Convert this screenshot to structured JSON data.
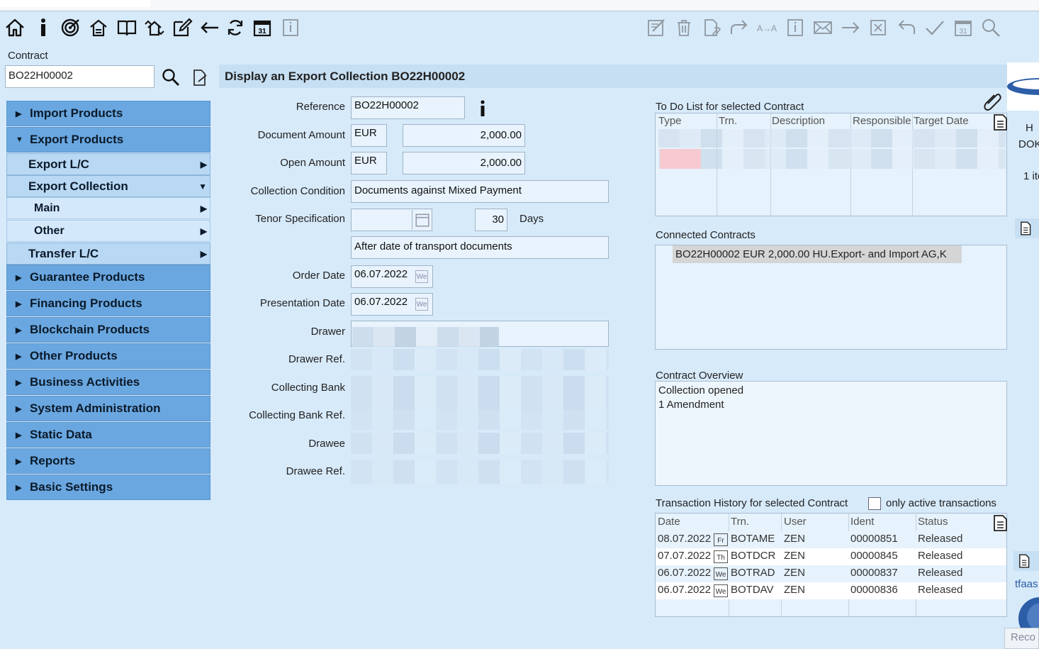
{
  "toolbar_left": [
    "home-icon",
    "info-icon",
    "target-icon",
    "hand-house-icon",
    "book-icon",
    "house-arrows-icon",
    "edit-icon",
    "back-arrow-icon",
    "refresh-icon",
    "calendar-icon",
    "info-box-icon"
  ],
  "toolbar_right": [
    "edit-sign-icon",
    "delete-icon",
    "document-attach-icon",
    "forward-icon",
    "transfer-icon",
    "info-box-icon",
    "mail-icon",
    "arrow-right-icon",
    "close-box-icon",
    "undo-icon",
    "check-icon",
    "calendar-icon",
    "search-icon"
  ],
  "contract": {
    "label": "Contract",
    "value": "BO22H00002"
  },
  "nav": {
    "import": "Import Products",
    "export": "Export Products",
    "export_lc": "Export L/C",
    "export_collection": "Export Collection",
    "main": "Main",
    "other": "Other",
    "transfer_lc": "Transfer L/C",
    "guarantee": "Guarantee Products",
    "financing": "Financing Products",
    "blockchain": "Blockchain Products",
    "other_products": "Other Products",
    "business": "Business Activities",
    "sysadmin": "System Administration",
    "static": "Static Data",
    "reports": "Reports",
    "basic": "Basic Settings"
  },
  "title": "Display an Export Collection BO22H00002",
  "form": {
    "reference_label": "Reference",
    "reference": "BO22H00002",
    "doc_amount_label": "Document Amount",
    "doc_currency": "EUR",
    "doc_amount": "2,000.00",
    "open_amount_label": "Open Amount",
    "open_currency": "EUR",
    "open_amount": "2,000.00",
    "collection_condition_label": "Collection Condition",
    "collection_condition": "Documents against Mixed Payment",
    "tenor_label": "Tenor Specification",
    "tenor_days": "30",
    "days_label": "Days",
    "tenor_text": "After date of transport documents",
    "order_date_label": "Order Date",
    "order_date": "06.07.2022",
    "presentation_date_label": "Presentation Date",
    "presentation_date": "06.07.2022",
    "drawer_label": "Drawer",
    "drawer_ref_label": "Drawer Ref.",
    "collecting_bank_label": "Collecting Bank",
    "collecting_bank_ref_label": "Collecting Bank Ref.",
    "drawee_label": "Drawee",
    "drawee_ref_label": "Drawee Ref."
  },
  "todo": {
    "title": "To Do List for selected Contract",
    "headers": [
      "Type",
      "Trn.",
      "Description",
      "Responsible",
      "Target Date"
    ]
  },
  "connected": {
    "title": "Connected Contracts",
    "item": "BO22H00002 EUR 2,000.00 HU.Export- and Import AG,K"
  },
  "overview": {
    "title": "Contract Overview",
    "line1": "Collection opened",
    "line2": "1 Amendment"
  },
  "history": {
    "title": "Transaction History for selected Contract",
    "only_active": "only active transactions",
    "headers": [
      "Date",
      "Trn.",
      "User",
      "Ident",
      "Status"
    ],
    "rows": [
      {
        "date": "08.07.2022",
        "badge": "Fr",
        "trn": "BOTAME",
        "user": "ZEN",
        "ident": "00000851",
        "status": "Released"
      },
      {
        "date": "07.07.2022",
        "badge": "Th",
        "trn": "BOTDCR",
        "user": "ZEN",
        "ident": "00000845",
        "status": "Released"
      },
      {
        "date": "06.07.2022",
        "badge": "We",
        "trn": "BOTRAD",
        "user": "ZEN",
        "ident": "00000837",
        "status": "Released"
      },
      {
        "date": "06.07.2022",
        "badge": "We",
        "trn": "BOTDAV",
        "user": "ZEN",
        "ident": "00000836",
        "status": "Released"
      }
    ]
  },
  "right_edge": {
    "t1": "H",
    "t2": "DOK",
    "t3": "1 ite",
    "t4": "tfaas",
    "t5": "Reco"
  },
  "we_badge": "We"
}
